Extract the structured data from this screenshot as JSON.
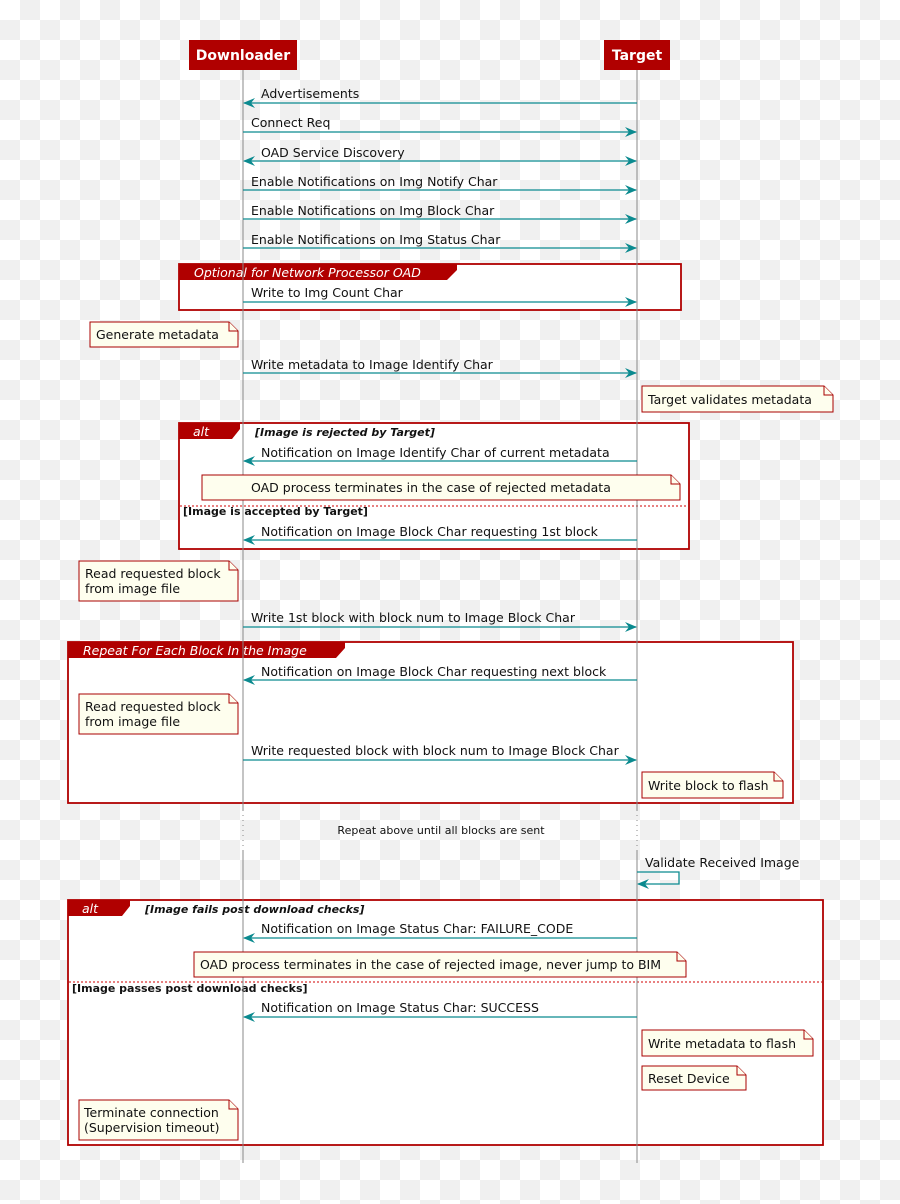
{
  "participants": {
    "downloader": "Downloader",
    "target": "Target"
  },
  "colors": {
    "participant": "#b00000",
    "arrow": "#0b8a8f",
    "frame": "#b00000",
    "note_fill": "#fefeee"
  },
  "messages": {
    "advertisements": "Advertisements",
    "connect_req": "Connect Req",
    "service_discovery": "OAD Service Discovery",
    "enable_notify": "Enable Notifications on Img Notify Char",
    "enable_block": "Enable Notifications on Img Block Char",
    "enable_status": "Enable Notifications on Img Status Char",
    "write_count": "Write to Img Count Char",
    "write_metadata": "Write metadata to Image Identify Char",
    "notif_identify": "Notification on Image Identify Char of current metadata",
    "notif_block_first": "Notification on Image Block Char requesting 1st block",
    "write_first_block": "Write 1st block with block num to Image Block Char",
    "notif_block_next": "Notification on Image Block Char requesting next block",
    "write_requested_block": "Write requested block with block num to Image Block Char",
    "validate_image": "Validate Received Image",
    "notif_failure": "Notification on Image Status Char: FAILURE_CODE",
    "notif_success": "Notification on Image Status Char: SUCCESS"
  },
  "frames": {
    "optional": {
      "label": "Optional for Network Processor OAD"
    },
    "alt1": {
      "label": "alt",
      "cond1": "[Image is rejected by Target]",
      "cond2": "[Image is accepted by Target]"
    },
    "loop": {
      "label": "Repeat For Each Block In the Image"
    },
    "alt2": {
      "label": "alt",
      "cond1": "[Image fails post download checks]",
      "cond2": "[Image passes post download checks]"
    }
  },
  "notes": {
    "generate_metadata": "Generate metadata",
    "target_validates": "Target validates metadata",
    "terminate_rejected_metadata": "OAD process terminates in the case of rejected metadata",
    "read_block_1": [
      "Read requested block",
      "from image file"
    ],
    "read_block_2": [
      "Read requested block",
      "from image file"
    ],
    "write_block_flash": "Write block to flash",
    "terminate_rejected_image": "OAD process terminates in the case of rejected image, never jump to BIM",
    "write_metadata_flash": "Write metadata to flash",
    "reset_device": "Reset Device",
    "terminate_connection": [
      "Terminate connection",
      "(Supervision timeout)"
    ]
  },
  "delay": "Repeat above until all blocks are sent"
}
